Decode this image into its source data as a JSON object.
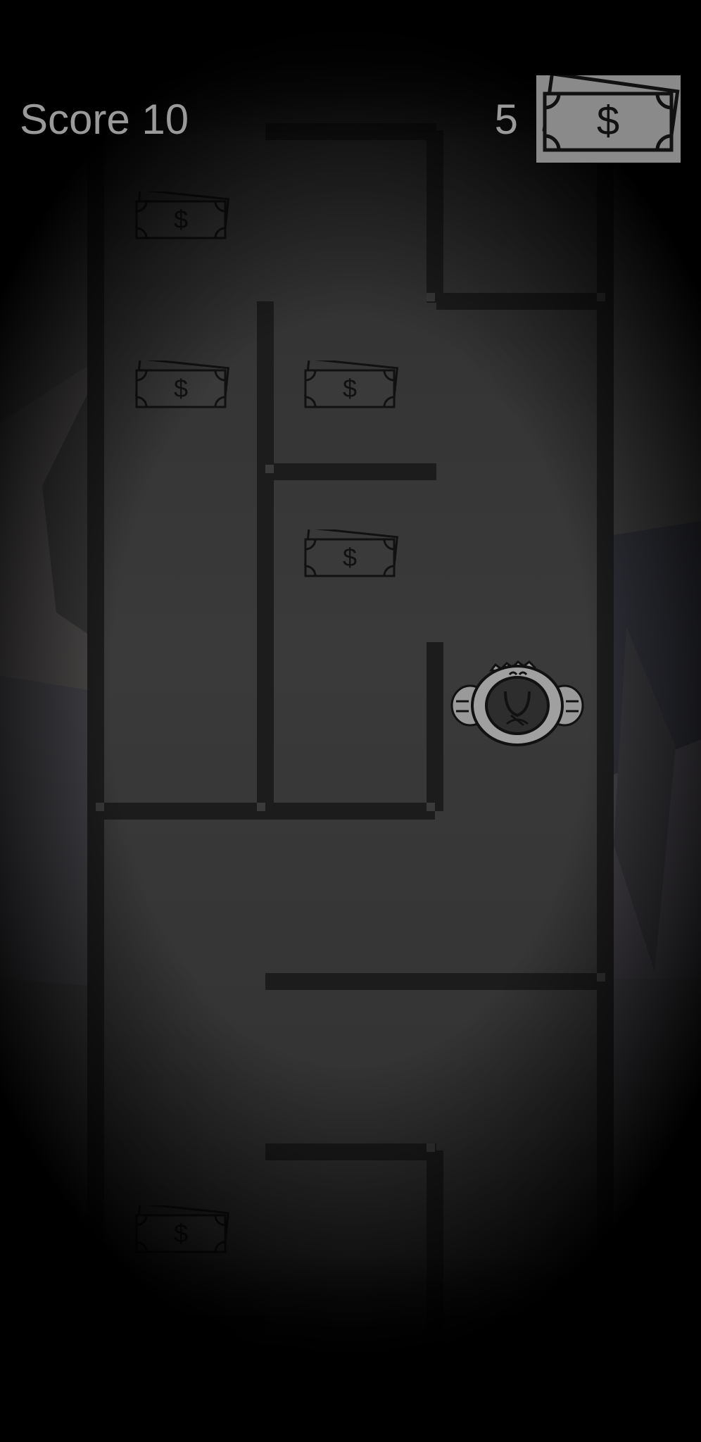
{
  "hud": {
    "score_label": "Score 10",
    "cash_count": "5",
    "cash_icon": "cash-icon"
  },
  "colors": {
    "background": "#333333",
    "wall": "#1c1c1c",
    "wall_highlight": "#3a3a3a",
    "hud_text": "#9a9a9a",
    "cash_badge": "#8a8a8a",
    "bill_stroke": "#111111"
  },
  "pickups": {
    "count": 6,
    "icon": "cash-bill-icon",
    "symbol": "$"
  },
  "player": {
    "icon": "player-character-icon"
  }
}
